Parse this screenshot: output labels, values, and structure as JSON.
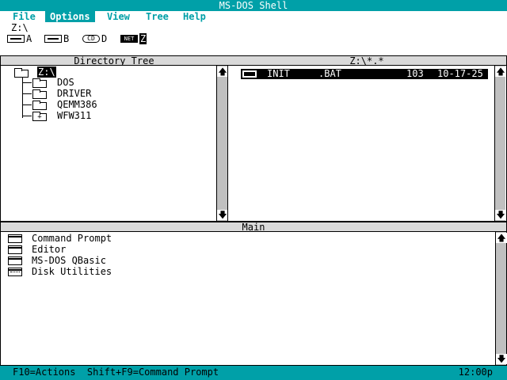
{
  "window": {
    "title": "MS-DOS Shell"
  },
  "menu": {
    "items": [
      "File",
      "Options",
      "View",
      "Tree",
      "Help"
    ],
    "active_index": 1
  },
  "current_path": "Z:\\",
  "drives": [
    {
      "letter": "A",
      "icon": "floppy-drive-icon"
    },
    {
      "letter": "B",
      "icon": "floppy-drive-icon"
    },
    {
      "letter": "D",
      "icon": "cd-drive-icon"
    },
    {
      "letter": "Z",
      "icon": "network-drive-icon",
      "icon_text": "NET",
      "selected": true
    }
  ],
  "directory_tree": {
    "title": "Directory Tree",
    "root": "Z:\\",
    "folders": [
      {
        "name": "DOS",
        "expandable": false
      },
      {
        "name": "DRIVER",
        "expandable": false
      },
      {
        "name": "QEMM386",
        "expandable": false
      },
      {
        "name": "WFW311",
        "expandable": true,
        "marker": "+"
      }
    ]
  },
  "file_list": {
    "title": "Z:\\*.*",
    "files": [
      {
        "name": "INIT",
        "ext": ".BAT",
        "size": "103",
        "date": "10-17-25",
        "selected": true
      }
    ]
  },
  "main_group": {
    "title": "Main",
    "items": [
      {
        "label": "Command Prompt",
        "icon": "program-icon"
      },
      {
        "label": "Editor",
        "icon": "program-icon"
      },
      {
        "label": "MS-DOS QBasic",
        "icon": "program-icon"
      },
      {
        "label": "Disk Utilities",
        "icon": "group-icon"
      }
    ]
  },
  "status": {
    "left": "F10=Actions  Shift+F9=Command Prompt",
    "time": "12:00p"
  },
  "colors": {
    "accent": "#00a0a8",
    "header_bg": "#d9d9d9",
    "selection_bg": "#000000"
  }
}
